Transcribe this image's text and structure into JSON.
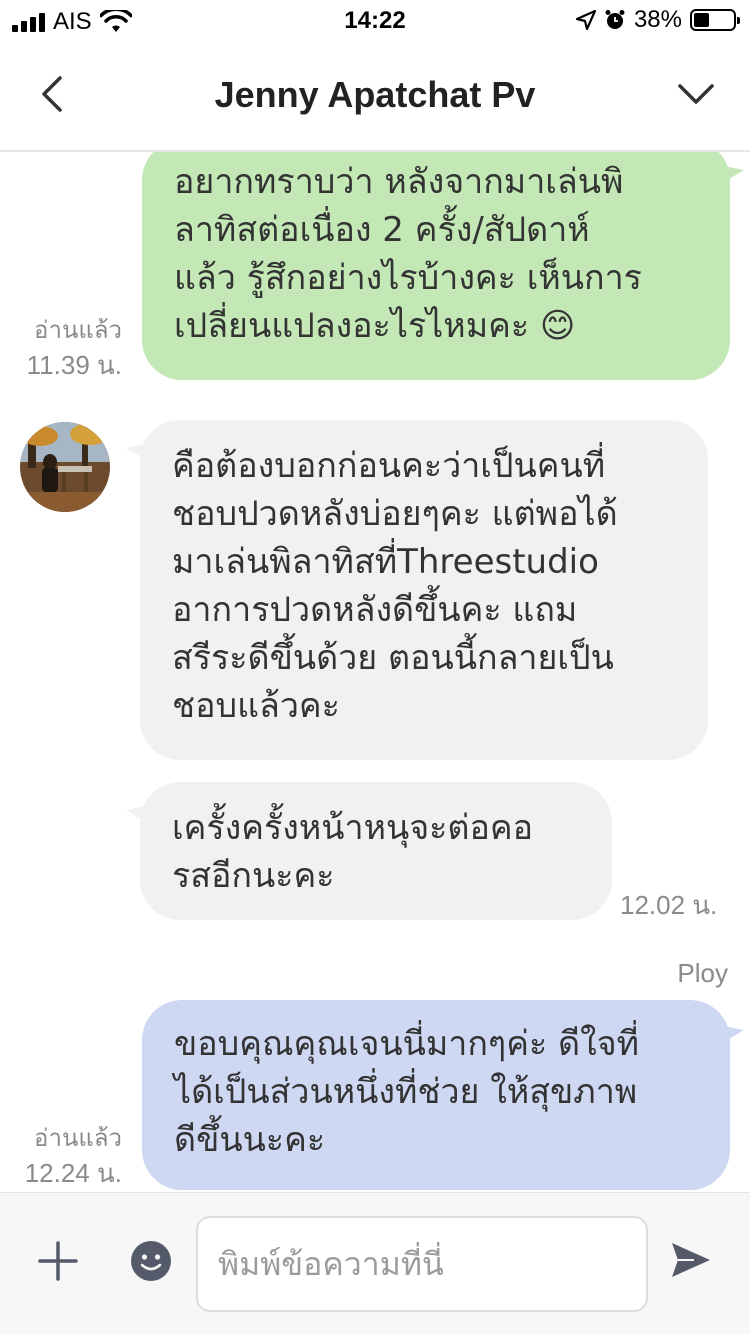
{
  "status_bar": {
    "carrier": "AIS",
    "time": "14:22",
    "battery": "38%",
    "battery_level": 0.38,
    "icons": [
      "signal-icon",
      "wifi-icon",
      "location-icon",
      "alarm-icon",
      "battery-icon"
    ]
  },
  "header": {
    "title": "Jenny Apatchat Pv",
    "back_icon": "back-chevron-icon",
    "menu_icon": "chevron-down-icon"
  },
  "messages": [
    {
      "side": "out",
      "lines": [
        "อยากทราบว่า หลังจากมาเล่นพิ",
        "ลาทิสต่อเนื่อง 2 ครั้ง/สัปดาห์",
        "แล้ว รู้สึกอย่างไรบ้างคะ เห็นการ",
        "เปลี่ยนแปลงอะไรไหมคะ 😊"
      ],
      "read": "อ่านแล้ว",
      "time": "11.39 น."
    },
    {
      "side": "in",
      "lines": [
        "คือต้องบอกก่อนคะว่าเป็นคนที่",
        "ชอบปวดหลังบ่อยๆคะ แต่พอได้",
        "มาเล่นพิลาทิสที่Threestudio",
        "อาการปวดหลังดีขึ้นคะ แถม",
        "สรีระดีขึ้นด้วย ตอนนี้กลายเป็น",
        "ชอบแล้วคะ"
      ]
    },
    {
      "side": "in",
      "lines": [
        "เครั้งครั้งหน้าหนุจะต่อคอ",
        "รสอีกนะคะ"
      ],
      "time": "12.02 น."
    },
    {
      "side": "out",
      "sender": "Ploy",
      "lines": [
        "ขอบคุณคุณเจนนี่มากๆค่ะ ดีใจที่",
        "ได้เป็นส่วนหนึ่งที่ช่วย ให้สุขภาพ",
        "ดีขึ้นนะคะ"
      ],
      "read": "อ่านแล้ว",
      "time": "12.24 น."
    }
  ],
  "input_bar": {
    "placeholder": "พิมพ์ข้อความที่นี่",
    "plus_icon": "plus-icon",
    "emoji_icon": "emoji-icon",
    "send_icon": "send-icon"
  },
  "colors": {
    "outgoing_bubble": "#c3e8b6",
    "incoming_bubble": "#f1f1f3",
    "ploy_bubble": "#cfd8f2",
    "meta_text": "#8a8a8a"
  }
}
